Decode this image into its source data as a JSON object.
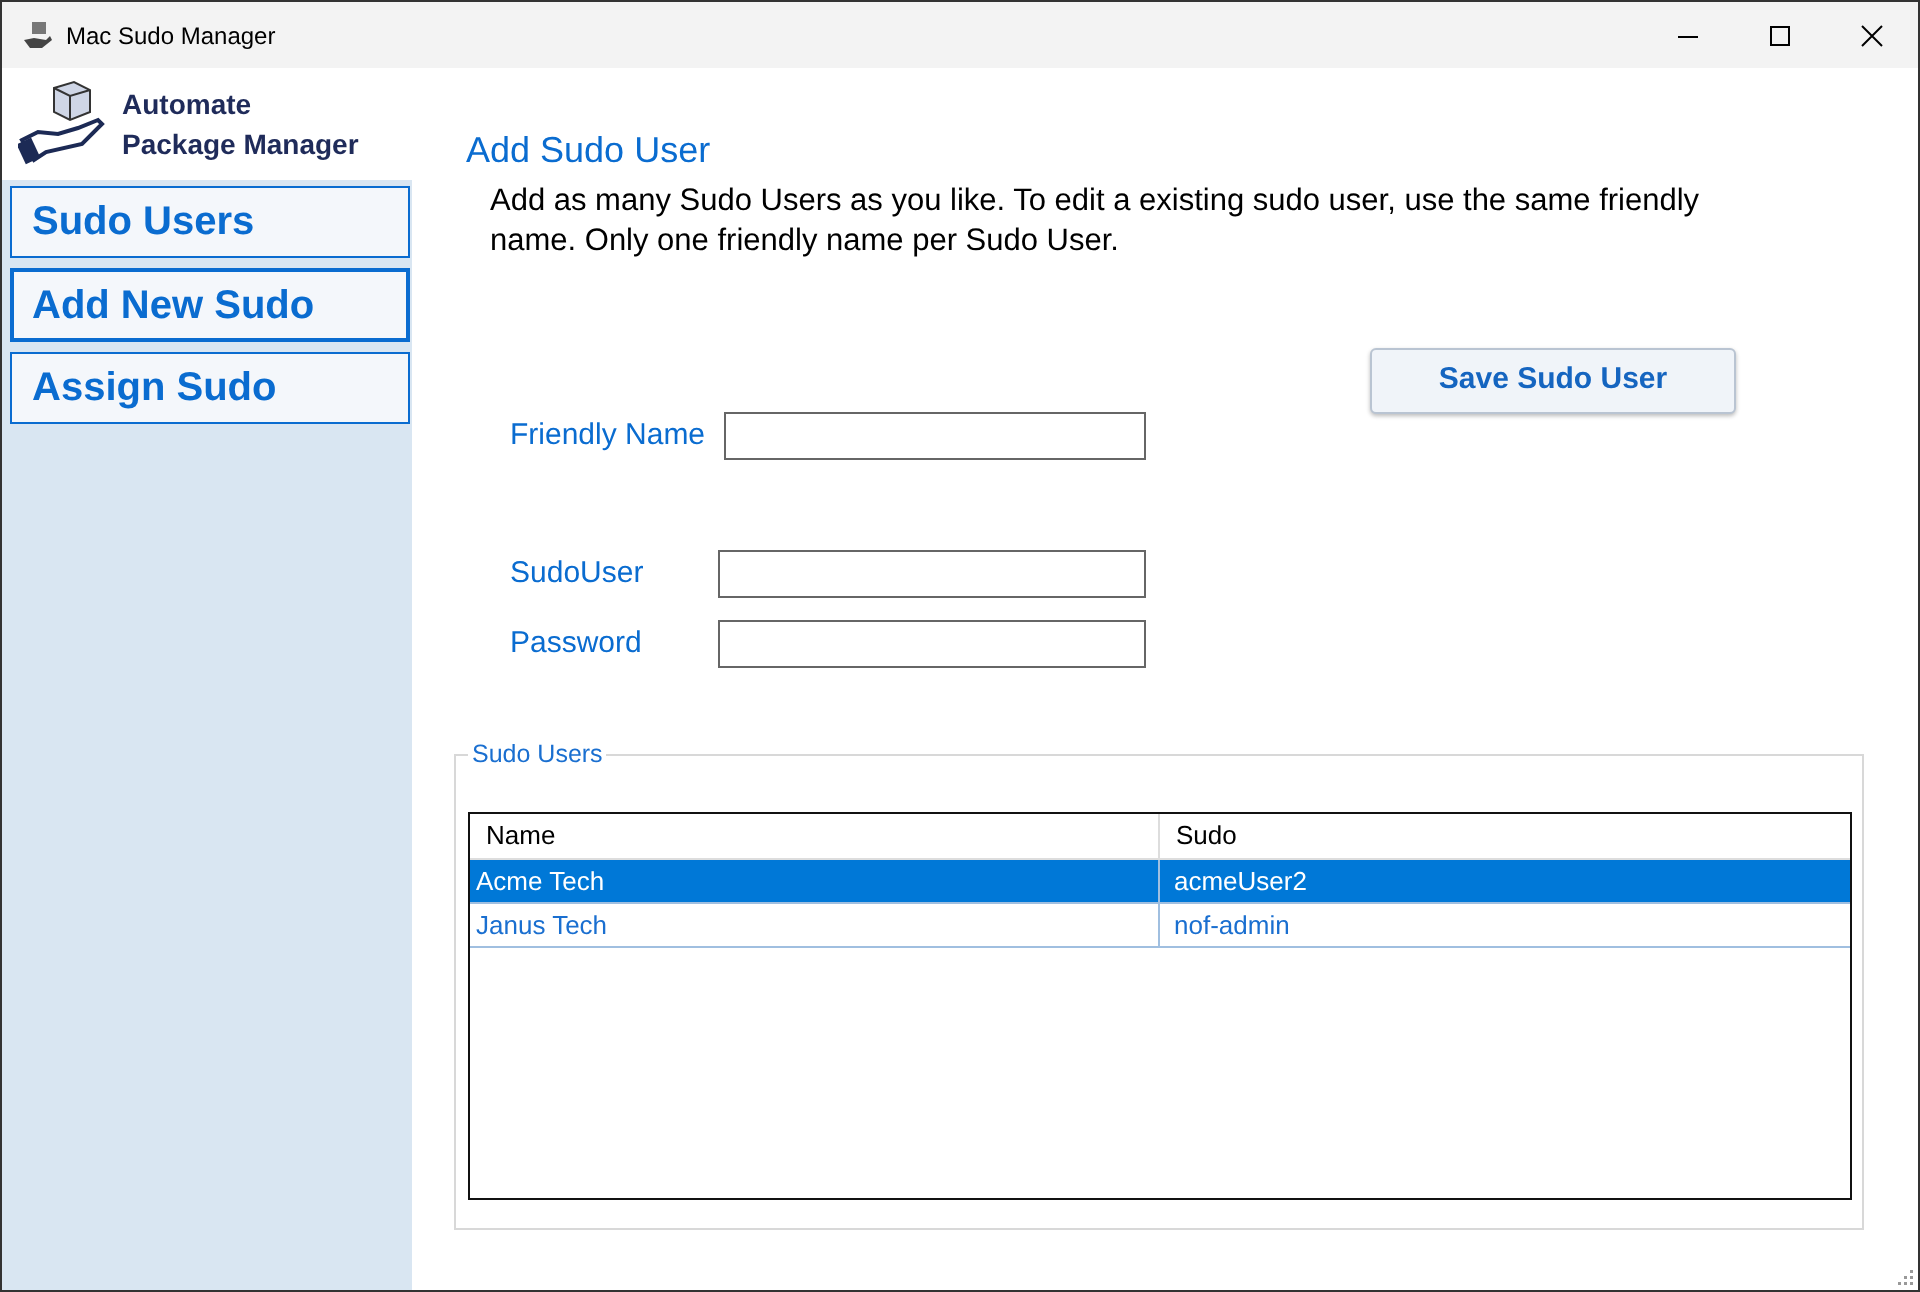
{
  "window": {
    "title": "Mac Sudo Manager"
  },
  "logo": {
    "line_1": "Automate",
    "line_2": "Package Manager"
  },
  "nav": [
    {
      "label": "Sudo Users",
      "selected": false
    },
    {
      "label": "Add New Sudo",
      "selected": true
    },
    {
      "label": "Assign Sudo",
      "selected": false
    }
  ],
  "heading": "Add Sudo User",
  "description": "Add as many Sudo Users as you like. To edit a existing sudo user, use the same friendly name. Only one friendly name per Sudo User.",
  "save_button": "Save Sudo User",
  "fields": [
    {
      "label": "Friendly Name"
    },
    {
      "label": "SudoUser"
    },
    {
      "label": "Password"
    }
  ],
  "group": {
    "title": "Sudo Users",
    "columns": [
      "Name",
      "Sudo"
    ],
    "rows": [
      {
        "cells": [
          "Acme Tech",
          "acmeUser2"
        ],
        "selected": true
      },
      {
        "cells": [
          "Janus Tech",
          "nof-admin"
        ],
        "selected": false
      }
    ]
  }
}
